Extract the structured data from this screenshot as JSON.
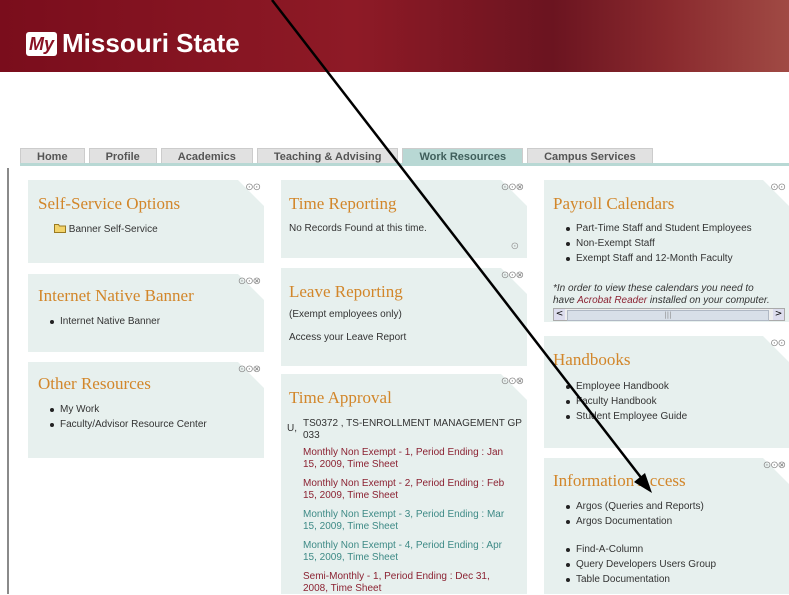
{
  "header": {
    "logo_my": "My",
    "logo_text": "Missouri State"
  },
  "tabs": [
    {
      "label": "Home"
    },
    {
      "label": "Profile"
    },
    {
      "label": "Academics"
    },
    {
      "label": "Teaching & Advising"
    },
    {
      "label": "Work Resources"
    },
    {
      "label": "Campus Services"
    }
  ],
  "self_service": {
    "title": "Self-Service Options",
    "folder_link": "Banner Self-Service"
  },
  "inb": {
    "title": "Internet Native Banner",
    "items": [
      "Internet Native Banner"
    ]
  },
  "other": {
    "title": "Other Resources",
    "items": [
      "My Work",
      "Faculty/Advisor Resource Center"
    ]
  },
  "time_reporting": {
    "title": "Time Reporting",
    "text": "No Records Found at this time."
  },
  "leave": {
    "title": "Leave Reporting",
    "note": "(Exempt employees only)",
    "link": "Access your Leave Report"
  },
  "approval": {
    "title": "Time Approval",
    "prefix": "U,",
    "org": "TS0372 ,  TS-ENROLLMENT MANAGEMENT GP 033",
    "sheets": [
      {
        "text": "Monthly Non Exempt -  1, Period Ending : Jan 15, 2009, Time Sheet",
        "color": "#8b2232"
      },
      {
        "text": "Monthly Non Exempt -  2, Period Ending : Feb 15, 2009, Time Sheet",
        "color": "#8b2232"
      },
      {
        "text": "Monthly Non Exempt -  3, Period Ending : Mar 15, 2009, Time Sheet",
        "color": "#3e8a86"
      },
      {
        "text": "Monthly Non Exempt -  4, Period Ending :  Apr 15, 2009, Time Sheet",
        "color": "#3e8a86"
      },
      {
        "text": "Semi-Monthly -  1, Period Ending :  Dec 31, 2008, Time Sheet",
        "color": "#8b2232"
      }
    ]
  },
  "payroll": {
    "title": "Payroll Calendars",
    "items": [
      "Part-Time Staff and Student Employees",
      "Non-Exempt Staff",
      "Exempt Staff and 12-Month Faculty"
    ],
    "note_1": "*In order to view these calendars you need to",
    "note_2_pre": "have ",
    "note_2_link": "Acrobat Reader",
    "note_2_post": " installed on your computer."
  },
  "handbooks": {
    "title": "Handbooks",
    "items": [
      "Employee Handbook",
      "Faculty Handbook",
      "Student Employee Guide"
    ]
  },
  "info": {
    "title": "Information Access",
    "items": [
      "Argos (Queries and Reports)",
      "Argos Documentation"
    ],
    "items2": [
      "Find-A-Column",
      "Query Developers Users Group",
      "Table Documentation"
    ]
  },
  "controls": {
    "three": "⊙⊙⊗",
    "two": "⊙⊙",
    "scroll_left": "<",
    "scroll_right": ">",
    "scroll_grip": "|||"
  },
  "colors": {
    "accent": "#d2862a",
    "panel": "#e7f0ee",
    "banner": "#7a0d1c",
    "active_tab": "#b8d8d4"
  }
}
